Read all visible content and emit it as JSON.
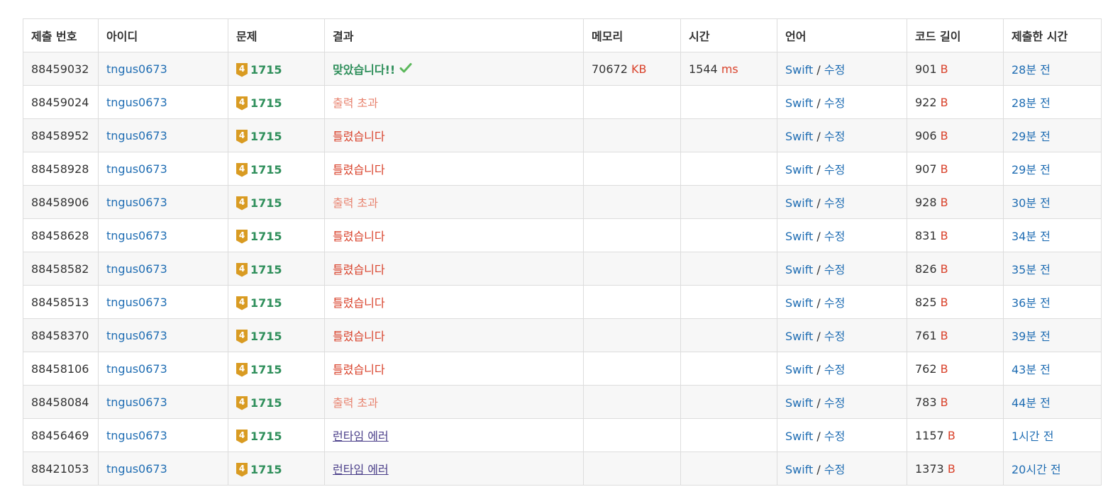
{
  "headers": [
    "제출 번호",
    "아이디",
    "문제",
    "결과",
    "메모리",
    "시간",
    "언어",
    "코드 길이",
    "제출한 시간"
  ],
  "colors": {
    "link": "#1f6db3",
    "accepted": "#2f8f5b",
    "wrong": "#d9422b",
    "output_exceeded": "#e8836f",
    "runtime_error": "#4b3f8a",
    "tier_badge": "#d99b22"
  },
  "unit_kb": "KB",
  "unit_ms": "ms",
  "unit_b": "B",
  "lang_sep": " / ",
  "edit_label": "수정",
  "rows": [
    {
      "submit_id": "88459032",
      "user": "tngus0673",
      "tier": "4",
      "problem": "1715",
      "result": "맞았습니다!!",
      "result_kind": "ac",
      "memory": "70672",
      "time": "1544",
      "lang": "Swift",
      "code_length": "901",
      "submitted": "28분 전"
    },
    {
      "submit_id": "88459024",
      "user": "tngus0673",
      "tier": "4",
      "problem": "1715",
      "result": "출력 초과",
      "result_kind": "ole",
      "memory": "",
      "time": "",
      "lang": "Swift",
      "code_length": "922",
      "submitted": "28분 전"
    },
    {
      "submit_id": "88458952",
      "user": "tngus0673",
      "tier": "4",
      "problem": "1715",
      "result": "틀렸습니다",
      "result_kind": "wa",
      "memory": "",
      "time": "",
      "lang": "Swift",
      "code_length": "906",
      "submitted": "29분 전"
    },
    {
      "submit_id": "88458928",
      "user": "tngus0673",
      "tier": "4",
      "problem": "1715",
      "result": "틀렸습니다",
      "result_kind": "wa",
      "memory": "",
      "time": "",
      "lang": "Swift",
      "code_length": "907",
      "submitted": "29분 전"
    },
    {
      "submit_id": "88458906",
      "user": "tngus0673",
      "tier": "4",
      "problem": "1715",
      "result": "출력 초과",
      "result_kind": "ole",
      "memory": "",
      "time": "",
      "lang": "Swift",
      "code_length": "928",
      "submitted": "30분 전"
    },
    {
      "submit_id": "88458628",
      "user": "tngus0673",
      "tier": "4",
      "problem": "1715",
      "result": "틀렸습니다",
      "result_kind": "wa",
      "memory": "",
      "time": "",
      "lang": "Swift",
      "code_length": "831",
      "submitted": "34분 전"
    },
    {
      "submit_id": "88458582",
      "user": "tngus0673",
      "tier": "4",
      "problem": "1715",
      "result": "틀렸습니다",
      "result_kind": "wa",
      "memory": "",
      "time": "",
      "lang": "Swift",
      "code_length": "826",
      "submitted": "35분 전"
    },
    {
      "submit_id": "88458513",
      "user": "tngus0673",
      "tier": "4",
      "problem": "1715",
      "result": "틀렸습니다",
      "result_kind": "wa",
      "memory": "",
      "time": "",
      "lang": "Swift",
      "code_length": "825",
      "submitted": "36분 전"
    },
    {
      "submit_id": "88458370",
      "user": "tngus0673",
      "tier": "4",
      "problem": "1715",
      "result": "틀렸습니다",
      "result_kind": "wa",
      "memory": "",
      "time": "",
      "lang": "Swift",
      "code_length": "761",
      "submitted": "39분 전"
    },
    {
      "submit_id": "88458106",
      "user": "tngus0673",
      "tier": "4",
      "problem": "1715",
      "result": "틀렸습니다",
      "result_kind": "wa",
      "memory": "",
      "time": "",
      "lang": "Swift",
      "code_length": "762",
      "submitted": "43분 전"
    },
    {
      "submit_id": "88458084",
      "user": "tngus0673",
      "tier": "4",
      "problem": "1715",
      "result": "출력 초과",
      "result_kind": "ole",
      "memory": "",
      "time": "",
      "lang": "Swift",
      "code_length": "783",
      "submitted": "44분 전"
    },
    {
      "submit_id": "88456469",
      "user": "tngus0673",
      "tier": "4",
      "problem": "1715",
      "result": "런타임 에러",
      "result_kind": "re",
      "memory": "",
      "time": "",
      "lang": "Swift",
      "code_length": "1157",
      "submitted": "1시간 전"
    },
    {
      "submit_id": "88421053",
      "user": "tngus0673",
      "tier": "4",
      "problem": "1715",
      "result": "런타임 에러",
      "result_kind": "re",
      "memory": "",
      "time": "",
      "lang": "Swift",
      "code_length": "1373",
      "submitted": "20시간 전"
    }
  ]
}
